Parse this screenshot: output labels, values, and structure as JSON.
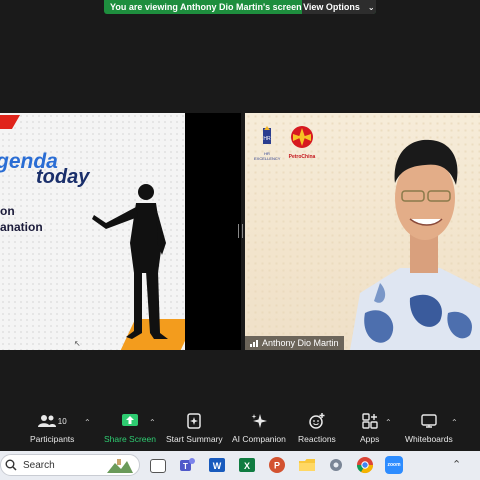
{
  "banner": {
    "message": "You are viewing Anthony Dio Martin's screen",
    "view_options": "View Options"
  },
  "slide": {
    "brand_line1": "genda",
    "brand_line2": "today",
    "topic_line1": "on",
    "topic_line2": "anation"
  },
  "video": {
    "participant_name": "Anthony Dio Martin",
    "logo_hr_text": "HR EXCELLENCY",
    "logo_petrochina_text": "PetroChina"
  },
  "toolbar": {
    "participants_count": "10",
    "participants": "Participants",
    "share_screen": "Share Screen",
    "start_summary": "Start Summary",
    "ai_companion": "AI Companion",
    "reactions": "Reactions",
    "apps": "Apps",
    "whiteboards": "Whiteboards"
  },
  "taskbar": {
    "search_placeholder": "Search",
    "apps": [
      "desktop-widget",
      "task-view",
      "teams",
      "word",
      "excel",
      "powerpoint",
      "file-explorer",
      "settings",
      "chrome",
      "zoom"
    ],
    "zoom_label": "zoom"
  },
  "colors": {
    "banner_green": "#1e8e3e",
    "share_green": "#2ecc71",
    "slide_orange": "#f39c1d",
    "slide_blue": "#2a6dd4"
  }
}
